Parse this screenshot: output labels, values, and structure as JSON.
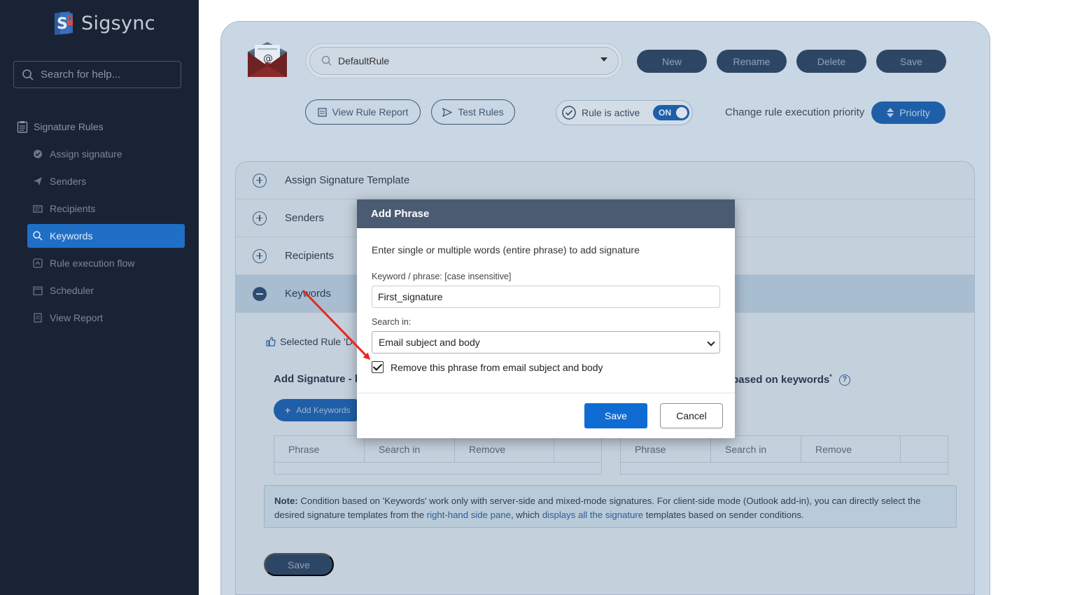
{
  "app": {
    "name": "Sigsync"
  },
  "sidebar": {
    "search_placeholder": "Search for help...",
    "section": "Signature Rules",
    "items": [
      {
        "label": "Assign signature",
        "icon": "check-badge-icon"
      },
      {
        "label": "Senders",
        "icon": "send-icon"
      },
      {
        "label": "Recipients",
        "icon": "recipients-icon"
      },
      {
        "label": "Keywords",
        "icon": "search-icon",
        "active": true
      },
      {
        "label": "Rule execution flow",
        "icon": "flow-icon"
      },
      {
        "label": "Scheduler",
        "icon": "calendar-icon"
      },
      {
        "label": "View Report",
        "icon": "report-icon"
      }
    ]
  },
  "toolbar": {
    "rule_name": "DefaultRule",
    "new": "New",
    "rename": "Rename",
    "delete": "Delete",
    "save": "Save",
    "view_report": "View Rule Report",
    "test_rules": "Test Rules",
    "rule_active": "Rule is active",
    "toggle": "ON",
    "priority_label": "Change rule execution priority",
    "priority": "Priority"
  },
  "accordion": {
    "assign": "Assign Signature Template",
    "senders": "Senders",
    "recipients": "Recipients",
    "keywords": "Keywords"
  },
  "keywords_section": {
    "selected_rule": "Selected Rule 'D",
    "add_title_left": "Add Signature - b",
    "add_title_right": "based on keywords",
    "add_keywords": "Add Keywords",
    "columns": [
      "Phrase",
      "Search in",
      "Remove"
    ],
    "note_bold": "Note:",
    "note_text1": " Condition based on 'Keywords' work only with server-side and mixed-mode signatures. For client-side mode (Outlook add-in), you can directly select the desired signature templates from the ",
    "note_link1": "right-hand side pane",
    "note_text2": ", which ",
    "note_link2": "displays all the signature",
    "note_text3": " templates based on sender conditions.",
    "save": "Save"
  },
  "modal": {
    "title": "Add Phrase",
    "description": "Enter single or multiple words (entire phrase) to add signature",
    "keyword_label": "Keyword / phrase: [case insensitive]",
    "keyword_value": "First_signature",
    "search_label": "Search in:",
    "search_value": "Email subject and body",
    "remove_label": "Remove this phrase from email subject and body",
    "remove_checked": true,
    "save": "Save",
    "cancel": "Cancel"
  },
  "colors": {
    "accent": "#0f6cd3",
    "sidebar_bg": "#1a2335",
    "arrow": "#e8261e"
  }
}
